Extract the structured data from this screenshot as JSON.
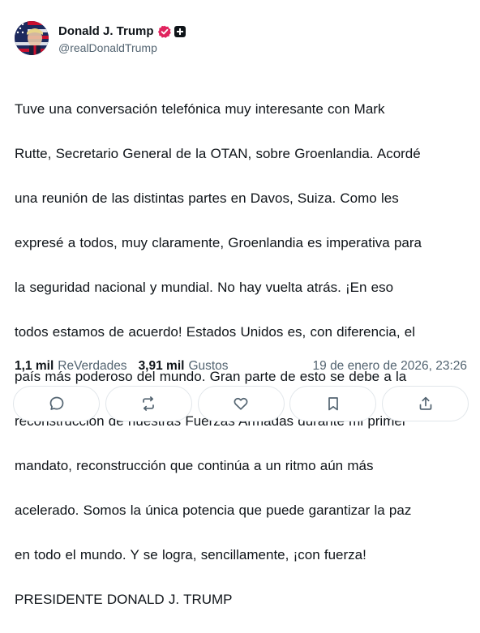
{
  "author": {
    "display_name": "Donald J. Trump",
    "handle": "@realDonaldTrump",
    "avatar_icon": "flag-portrait-avatar",
    "verified_color": "#e0245e"
  },
  "post": {
    "lines": [
      "Tuve una conversación telefónica muy interesante con Mark",
      "Rutte, Secretario General de la OTAN, sobre Groenlandia. Acordé",
      "una reunión de las distintas partes en Davos, Suiza. Como les",
      "expresé a todos, muy claramente, Groenlandia es imperativa para",
      "la seguridad nacional y mundial. No hay vuelta atrás. ¡En eso",
      "todos estamos de acuerdo! Estados Unidos es, con diferencia, el",
      "país más poderoso del mundo. Gran parte de esto se debe a la",
      "reconstrucción de nuestras Fuerzas Armadas durante mi primer",
      "mandato, reconstrucción que continúa a un ritmo aún más",
      "acelerado. Somos la única potencia que puede garantizar la paz",
      "en todo el mundo. Y se logra, sencillamente, ¡con fuerza!",
      "PRESIDENTE DONALD J. TRUMP"
    ]
  },
  "stats": {
    "retruths_count": "1,1 mil",
    "retruths_label": "ReVerdades",
    "likes_count": "3,91 mil",
    "likes_label": "Gustos",
    "timestamp": "19 de enero de 2026, 23:26"
  },
  "actions": [
    {
      "icon": "reply-icon"
    },
    {
      "icon": "retruth-icon"
    },
    {
      "icon": "like-icon"
    },
    {
      "icon": "bookmark-icon"
    },
    {
      "icon": "share-icon"
    }
  ],
  "colors": {
    "text": "#0f1419",
    "muted": "#536471",
    "border": "#e1e6ea",
    "icon": "#536471"
  }
}
